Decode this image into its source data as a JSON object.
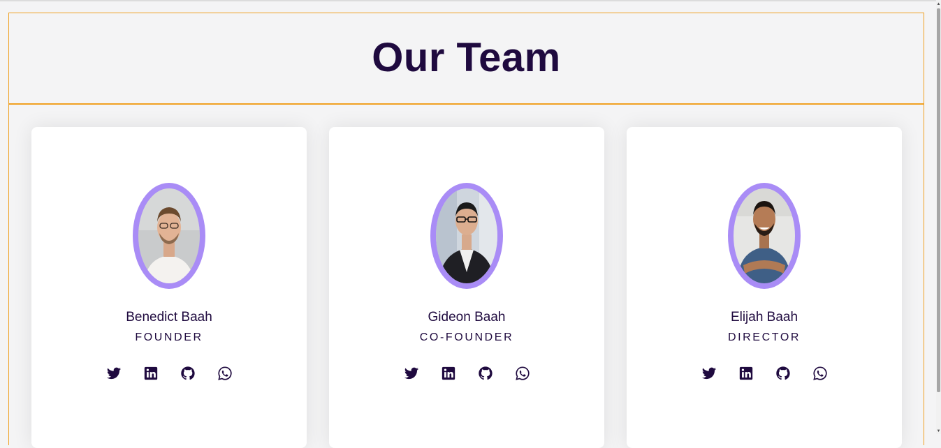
{
  "page": {
    "title": "Our Team"
  },
  "colors": {
    "accent_border": "#f0a020",
    "heading": "#1f0a3f",
    "avatar_ring": "#a98cf6",
    "card_bg": "#ffffff",
    "page_bg": "#f4f4f5"
  },
  "members": [
    {
      "name": "Benedict Baah",
      "role": "FOUNDER",
      "socials": [
        "twitter-icon",
        "linkedin-icon",
        "github-icon",
        "whatsapp-icon"
      ]
    },
    {
      "name": "Gideon Baah",
      "role": "CO-FOUNDER",
      "socials": [
        "twitter-icon",
        "linkedin-icon",
        "github-icon",
        "whatsapp-icon"
      ]
    },
    {
      "name": "Elijah Baah",
      "role": "DIRECTOR",
      "socials": [
        "twitter-icon",
        "linkedin-icon",
        "github-icon",
        "whatsapp-icon"
      ]
    }
  ]
}
